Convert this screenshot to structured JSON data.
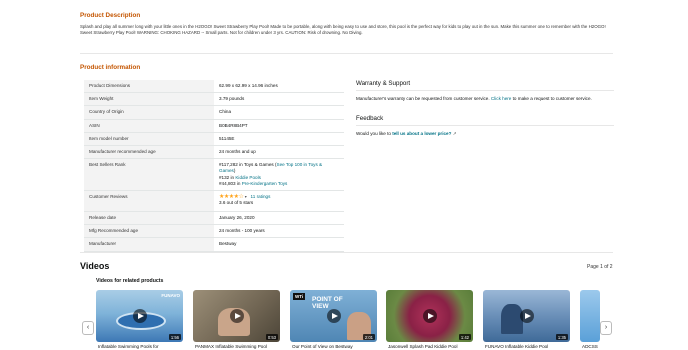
{
  "description": {
    "title": "Product Description",
    "text": "Splash and play all summer long with your little ones in the H2OGO! Sweet Strawberry Play Pool! Made to be portable, along with being easy to use and store, this pool is the perfect way for kids to play out in the sun. Make this summer one to remember with the H2OGO! Sweet Strawberry Play Pool! WARNING: CHOKING HAZARD -- Small parts. Not for children under 3 yrs. CAUTION: Risk of drowning. No Diving."
  },
  "info": {
    "title": "Product information",
    "rows": [
      {
        "k": "Product Dimensions",
        "v": "62.99 x 62.99 x 14.96 inches"
      },
      {
        "k": "Item Weight",
        "v": "3.79 pounds"
      },
      {
        "k": "Country of Origin",
        "v": "China"
      },
      {
        "k": "ASIN",
        "v": "B0B4R8B4PT"
      },
      {
        "k": "Item model number",
        "v": "51145E"
      },
      {
        "k": "Manufacturer recommended age",
        "v": "24 months and up"
      }
    ],
    "bsr": {
      "k": "Best Sellers Rank",
      "line1": "#117,282 in Toys & Games (",
      "line1_link": "See Top 100 in Toys & Games",
      "line1_end": ")",
      "line2": "#132 in ",
      "line2_link": "Kiddie Pools",
      "line3": "#44,803 in ",
      "line3_link": "Pre-Kindergarten Toys"
    },
    "reviews": {
      "k": "Customer Reviews",
      "stars": "★★★★☆",
      "caret": "▾",
      "count": "11 ratings",
      "rating": "3.6 out of 5 stars"
    },
    "rows2": [
      {
        "k": "Release date",
        "v": "January 26, 2020"
      },
      {
        "k": "Mfg Recommended age",
        "v": "24 months - 100 years"
      },
      {
        "k": "Manufacturer",
        "v": "Bestway"
      }
    ]
  },
  "warranty": {
    "title": "Warranty & Support",
    "text_pre": "Manufacturer's warranty can be requested from customer service. ",
    "link": "Click here",
    "text_post": " to make a request to customer service."
  },
  "feedback": {
    "title": "Feedback",
    "pre": "Would you like to ",
    "link": "tell us about a lower price?",
    "icon": "↗"
  },
  "videos": {
    "title": "Videos",
    "pager": "Page 1 of 2",
    "related": "Videos for related products",
    "prev": "‹",
    "next": "›",
    "items": [
      {
        "caption": "Inflatable Swimming Pools for",
        "duration": "1:56",
        "bg": "#6d9bc3"
      },
      {
        "caption": "PANMAX Inflatable Swimming Pool",
        "duration": "0:53",
        "bg": "#8a7d68"
      },
      {
        "caption": "Our Point of View on Bestway",
        "duration": "2:01",
        "bg": "#5a8fb8"
      },
      {
        "caption": "Jasonwell Splash Pad Kiddie Pool",
        "duration": "1:42",
        "bg": "#6f8c4a"
      },
      {
        "caption": "FUNAVO Inflatable Kiddie Pool",
        "duration": "1:35",
        "bg": "#5d7ca0"
      },
      {
        "caption": "ADCSS",
        "duration": "",
        "bg": "#6aa6d8"
      }
    ],
    "badges": {
      "wt": "WTi",
      "pov": "POINT OF VIEW",
      "funavo": "FUNAVO"
    }
  }
}
